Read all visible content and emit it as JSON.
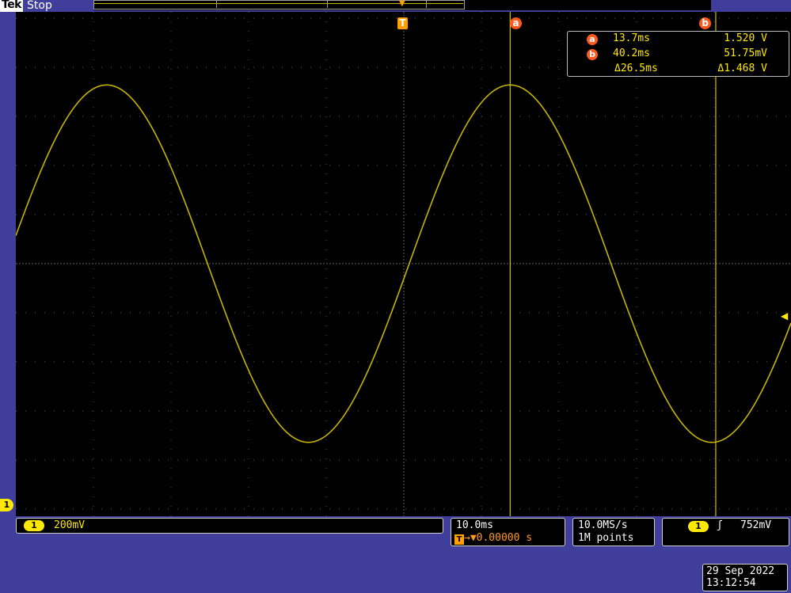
{
  "top_bar": {
    "brand": "Tek",
    "status": "Stop"
  },
  "markers": {
    "trigger": "T",
    "cursor_a": "a",
    "cursor_b": "b"
  },
  "cursor_readout": {
    "rows": [
      {
        "badge": "a",
        "time": "13.7ms",
        "value": "1.520 V"
      },
      {
        "badge": "b",
        "time": "40.2ms",
        "value": "51.75mV"
      },
      {
        "badge": "",
        "time": "Δ26.5ms",
        "value": "Δ1.468 V"
      }
    ]
  },
  "channel": {
    "number": "1",
    "scale": "200mV",
    "color": "#ffe800"
  },
  "horizontal": {
    "scale": "10.0ms",
    "trigger_icon": "T",
    "position": "→▼0.00000 s"
  },
  "acquisition": {
    "sample_rate": "10.0MS/s",
    "record_length": "1M points"
  },
  "trigger": {
    "source": "1",
    "slope": "ʃ",
    "level": "752mV"
  },
  "clock": {
    "date": "29 Sep  2022",
    "time": "13:12:54"
  },
  "waveform": {
    "period_ms": 52,
    "time_per_div_ms": 10,
    "phase_at_left_edge_ms": -48.2,
    "amplitude_div": 3.64,
    "offset_div": 0,
    "color": "#c6b400"
  },
  "colors": {
    "background": "#3f3f9b",
    "graticule_bg": "#000000",
    "grid": "#6a6a6a",
    "cursor_line": "#ffe800",
    "marker": "#ff5a1e",
    "trigger_marker": "#ffa000"
  }
}
